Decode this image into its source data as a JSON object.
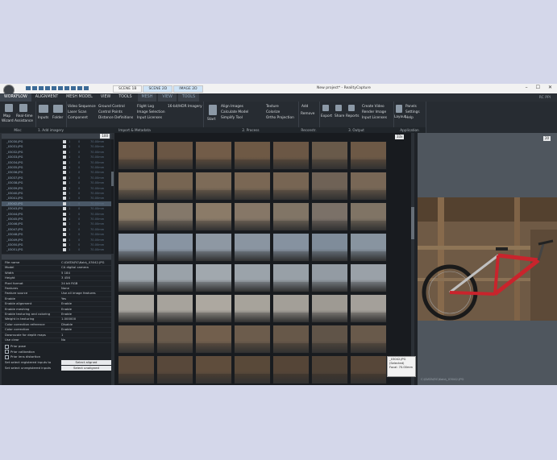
{
  "window": {
    "title": "New project* - RealityCapture",
    "version": "RC PPI",
    "scene_tabs": [
      "SCENE 1B",
      "SCENE 2D",
      "IMAGE 2D"
    ],
    "buttons": [
      "–",
      "☐",
      "✕"
    ]
  },
  "menu": {
    "items": [
      "WORKFLOW",
      "ALIGNMENT",
      "MESH MODEL",
      "VIEW",
      "TOOLS"
    ],
    "active": "WORKFLOW",
    "extra_tabs": [
      "MESH",
      "VIEW",
      "TOOLS"
    ]
  },
  "ribbon": {
    "groups": [
      {
        "label": "Misc",
        "buttons": [
          "Map",
          "Real-time",
          "Wizard Assistance"
        ]
      },
      {
        "label": "1. Add imagery",
        "buttons": [
          "Inputs",
          "Folder"
        ]
      },
      {
        "label": "Import & Metadata",
        "buttons": [
          "Video Sequence",
          "Ground Control",
          "Laser Scan",
          "Control Points",
          "Component",
          "Distance Definitions",
          "Flight Log",
          "Image Selection",
          "Input Licenses",
          "16-bit/HDR Imagery"
        ]
      },
      {
        "label": "2. Process",
        "buttons": [
          "Start",
          "Align Images",
          "Calculate Model",
          "Simplify Tool",
          "Texture",
          "Colorize",
          "Ortho Projection"
        ]
      },
      {
        "label": "Reconstr.",
        "buttons": [
          "Add",
          "Remove"
        ]
      },
      {
        "label": "3. Output",
        "buttons": [
          "Export",
          "Share",
          "Reports",
          "Create Video",
          "Render Image",
          "Input Licenses"
        ]
      },
      {
        "label": "Application",
        "buttons": [
          "Layout",
          "Panels",
          "Settings",
          "Help"
        ]
      }
    ]
  },
  "file_list": {
    "zoom": "100",
    "rows": [
      {
        "name": "_03030.JPG",
        "v1": "1",
        "v2": "0",
        "v3": "70.00mm"
      },
      {
        "name": "_03031.JPG",
        "v1": "1",
        "v2": "0",
        "v3": "70.00mm"
      },
      {
        "name": "_03032.JPG",
        "v1": "1",
        "v2": "0",
        "v3": "70.00mm"
      },
      {
        "name": "_03033.JPG",
        "v1": "1",
        "v2": "0",
        "v3": "70.00mm"
      },
      {
        "name": "_03034.JPG",
        "v1": "1",
        "v2": "0",
        "v3": "70.00mm"
      },
      {
        "name": "_03035.JPG",
        "v1": "1",
        "v2": "0",
        "v3": "70.00mm"
      },
      {
        "name": "_03036.JPG",
        "v1": "1",
        "v2": "0",
        "v3": "70.00mm"
      },
      {
        "name": "_03037.JPG",
        "v1": "1",
        "v2": "0",
        "v3": "70.00mm"
      },
      {
        "name": "_03038.JPG",
        "v1": "1",
        "v2": "0",
        "v3": "70.00mm"
      },
      {
        "name": "_03039.JPG",
        "v1": "1",
        "v2": "0",
        "v3": "70.00mm"
      },
      {
        "name": "_03040.JPG",
        "v1": "1",
        "v2": "0",
        "v3": "70.00mm"
      },
      {
        "name": "_03041.JPG",
        "v1": "1",
        "v2": "0",
        "v3": "70.00mm"
      },
      {
        "name": "_03042.JPG",
        "v1": "1",
        "v2": "0",
        "v3": "70.00mm"
      },
      {
        "name": "_03043.JPG",
        "v1": "1",
        "v2": "0",
        "v3": "70.00mm"
      },
      {
        "name": "_03044.JPG",
        "v1": "1",
        "v2": "0",
        "v3": "70.00mm"
      },
      {
        "name": "_03045.JPG",
        "v1": "1",
        "v2": "0",
        "v3": "70.00mm"
      },
      {
        "name": "_03046.JPG",
        "v1": "1",
        "v2": "0",
        "v3": "70.00mm"
      },
      {
        "name": "_03047.JPG",
        "v1": "1",
        "v2": "0",
        "v3": "70.00mm"
      },
      {
        "name": "_03048.JPG",
        "v1": "1",
        "v2": "0",
        "v3": "70.00mm"
      },
      {
        "name": "_03049.JPG",
        "v1": "1",
        "v2": "0",
        "v3": "70.00mm"
      },
      {
        "name": "_03050.JPG",
        "v1": "1",
        "v2": "0",
        "v3": "70.00mm"
      },
      {
        "name": "_03051.JPG",
        "v1": "1",
        "v2": "0",
        "v3": "70.00mm"
      }
    ],
    "selected_index": 12
  },
  "properties": {
    "rows": [
      {
        "k": "File name",
        "v": "C:\\DATA\\RC\\Kolo\\_03042.JPG"
      },
      {
        "k": "Model",
        "v": "CA digital camera"
      },
      {
        "k": "Width",
        "v": "5 184"
      },
      {
        "k": "Height",
        "v": "3 456"
      },
      {
        "k": "Pixel format",
        "v": "24 bit RGB"
      },
      {
        "k": "Features",
        "v": "None"
      },
      {
        "k": "Feature source",
        "v": "Use all image features"
      },
      {
        "k": "Enable",
        "v": "Yes"
      },
      {
        "k": "Enable alignment",
        "v": "Enable"
      },
      {
        "k": "Enable meshing",
        "v": "Enable"
      },
      {
        "k": "Enable texturing and coloring",
        "v": "Enable"
      },
      {
        "k": "Weight in texturing",
        "v": "1.000000"
      },
      {
        "k": "Color correction reference",
        "v": "Disable"
      },
      {
        "k": "Color correction",
        "v": "Enable"
      },
      {
        "k": "Downscale for depth maps",
        "v": "1"
      },
      {
        "k": "Use clear",
        "v": "No"
      }
    ],
    "checks": [
      "Prior pose",
      "Prior calibration",
      "Prior lens distortion"
    ],
    "select_rows": [
      {
        "k": "Set select registered inputs to",
        "btn": "Select aligned"
      },
      {
        "k": "Set select unregistered inputs",
        "btn": "Select unaligned"
      }
    ]
  },
  "thumbnails": {
    "zoom": "33x",
    "tooltip": [
      "_03042.JPG",
      "(Selected)",
      "Focal: 70.00mm"
    ],
    "cols": 7,
    "rows": [
      [
        "#6f5a47",
        "#6a5644",
        "#725c48",
        "#6e5945",
        "#6b5745",
        "#695a4a",
        "#6d5946"
      ],
      [
        "#7b6a57",
        "#776552",
        "#7d6b58",
        "#7a6754",
        "#776553",
        "#6f6256",
        "#786756"
      ],
      [
        "#8b7c68",
        "#84786a",
        "#8b7b68",
        "#867767",
        "#817566",
        "#7b7168",
        "#807465"
      ],
      [
        "#8e9aa8",
        "#8894a2",
        "#8e98a3",
        "#8a95a1",
        "#8692a0",
        "#7f8c9a",
        "#8894a0"
      ],
      [
        "#9ea6ad",
        "#9aa2a9",
        "#a1a8ae",
        "#9ba3aa",
        "#98a0a7",
        "#939ba3",
        "#9aa1a8"
      ],
      [
        "#a9a6a0",
        "#a7a39c",
        "#ada8a0",
        "#a7a39b",
        "#a39f98",
        "#9e9a93",
        "#a4a09a"
      ],
      [
        "#6d5e4f",
        "#6a5b4c",
        "#725f4d",
        "#6c5c4c",
        "#675849",
        "#605448",
        "#695a4b"
      ],
      [
        "#5b4a3b",
        "#58483a",
        "#5f4d3c",
        "#594939",
        "#554537",
        "#4f4236",
        "#574739"
      ]
    ]
  },
  "preview": {
    "zoom": "20",
    "caption": "C:\\DATA\\RC\\Kolo\\_03042.JPG"
  }
}
